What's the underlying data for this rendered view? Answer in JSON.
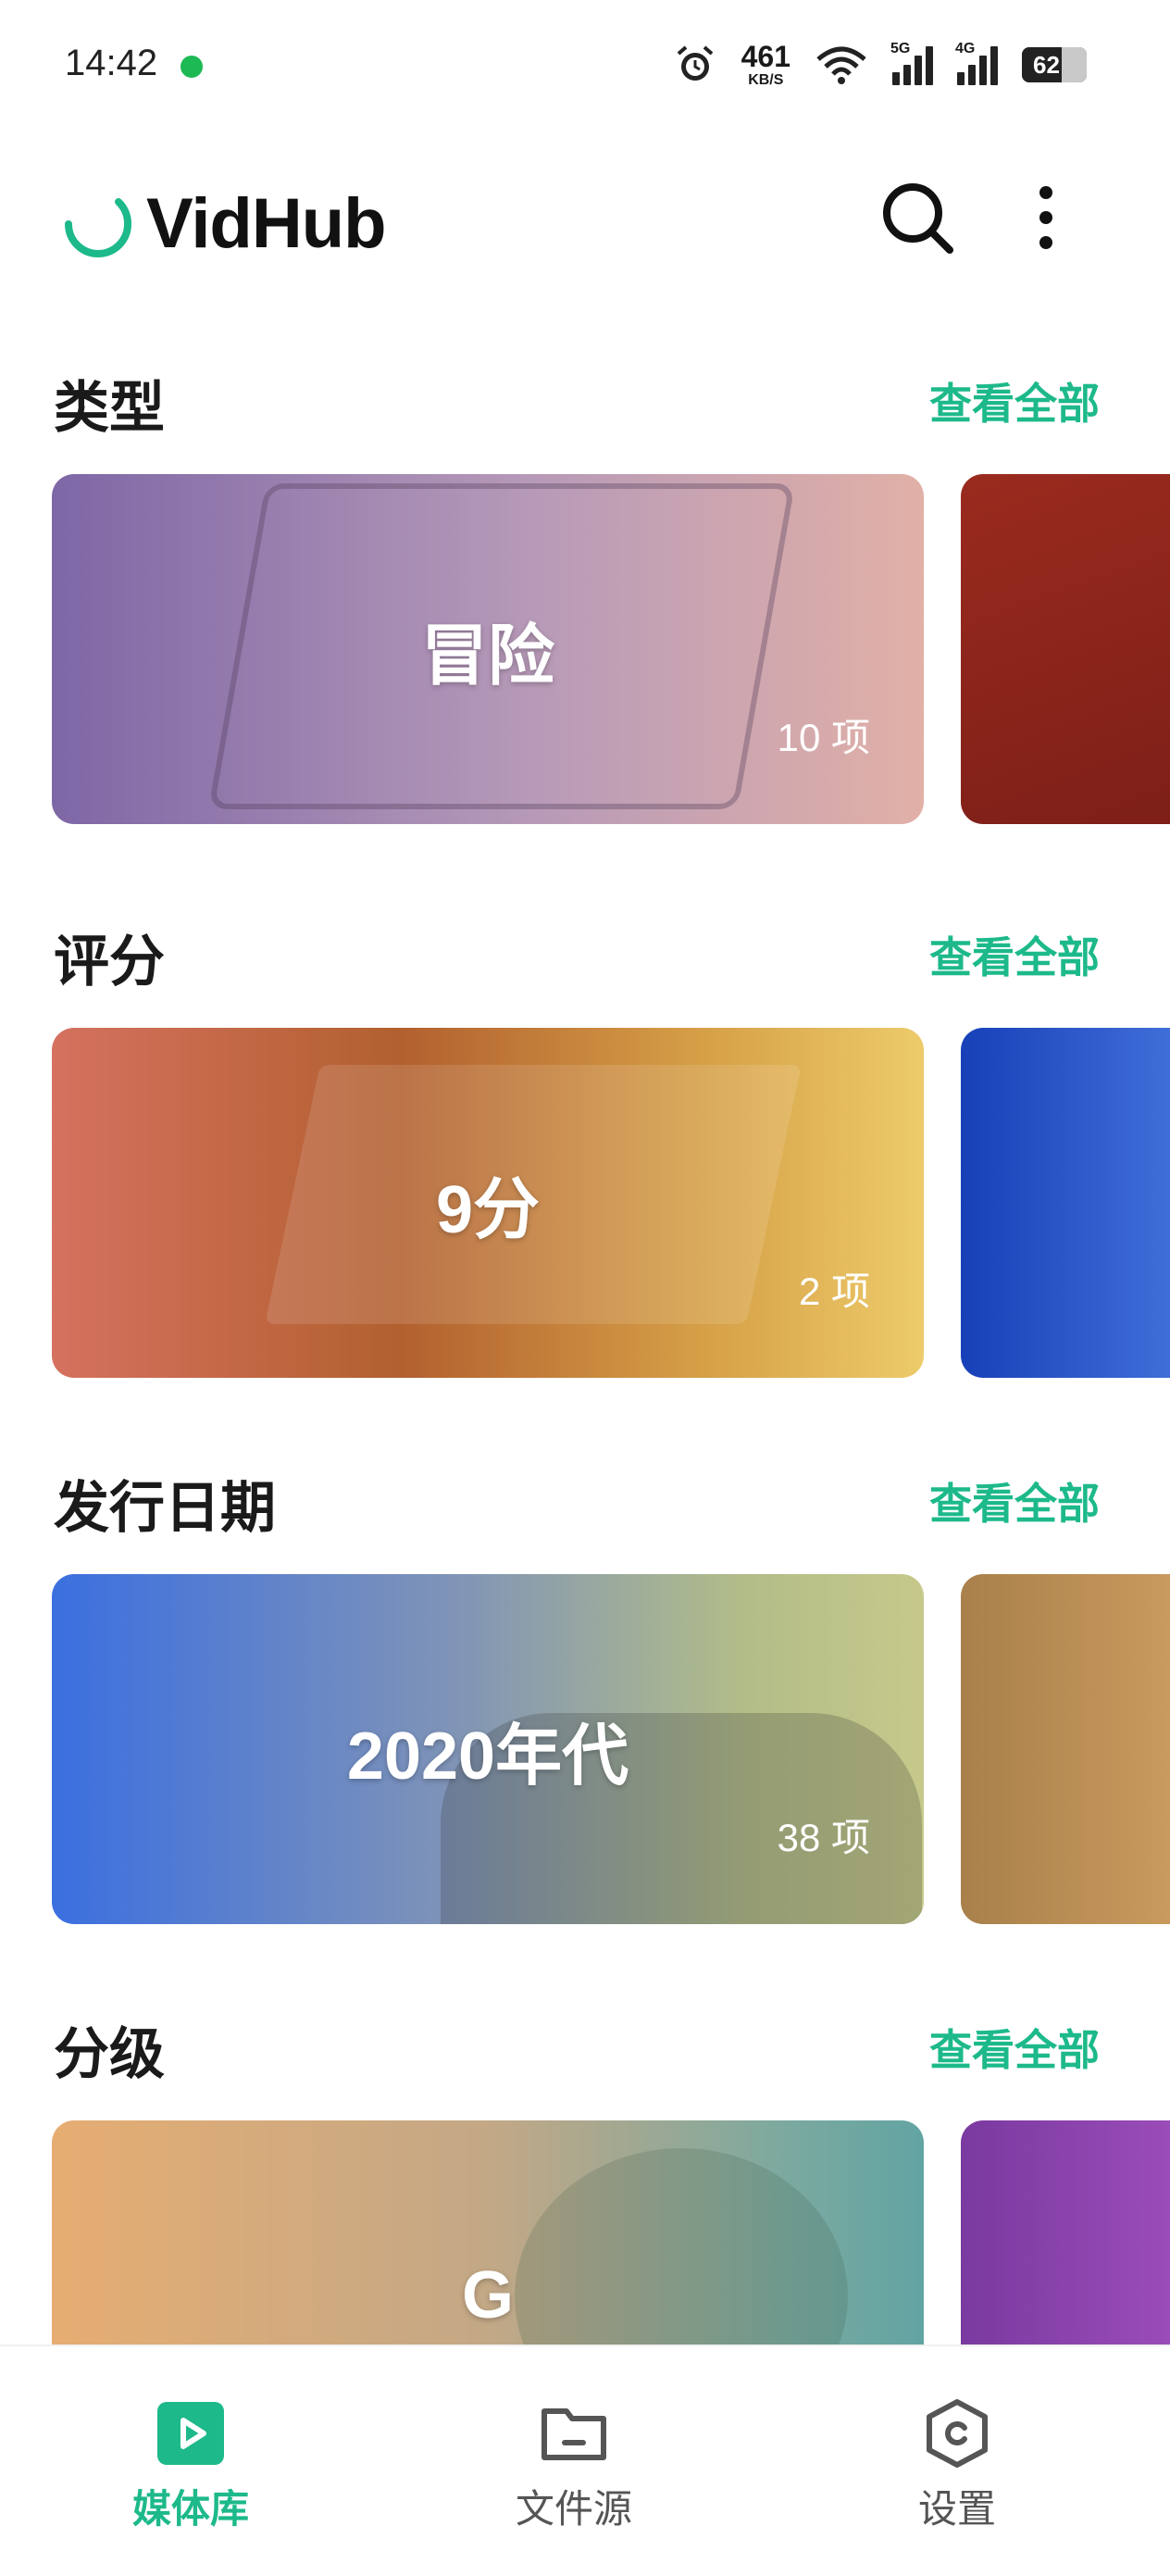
{
  "status_bar": {
    "time": "14:42",
    "net_speed": "461",
    "net_unit": "KB/S",
    "sim1": "5G",
    "sim2": "4G",
    "battery": "62",
    "notification_color": "#1db954"
  },
  "header": {
    "logo_text": "VidHub",
    "brand_color": "#1db98a",
    "search_icon": "search-icon",
    "more_icon": "more-vertical-icon"
  },
  "sections": [
    {
      "title": "类型",
      "see_all": "查看全部",
      "card_label": "冒险",
      "card_count": "10 项"
    },
    {
      "title": "评分",
      "see_all": "查看全部",
      "card_label": "9分",
      "card_count": "2 项"
    },
    {
      "title": "发行日期",
      "see_all": "查看全部",
      "card_label": "2020年代",
      "card_count": "38 项"
    },
    {
      "title": "分级",
      "see_all": "查看全部",
      "card_label": "G",
      "card_count": ""
    }
  ],
  "bottom_nav": [
    {
      "label": "媒体库",
      "icon": "play-library-icon",
      "active": true
    },
    {
      "label": "文件源",
      "icon": "folder-icon",
      "active": false
    },
    {
      "label": "设置",
      "icon": "settings-hexagon-icon",
      "active": false
    }
  ],
  "colors": {
    "accent": "#1db98a",
    "inactive_nav": "#555555"
  }
}
